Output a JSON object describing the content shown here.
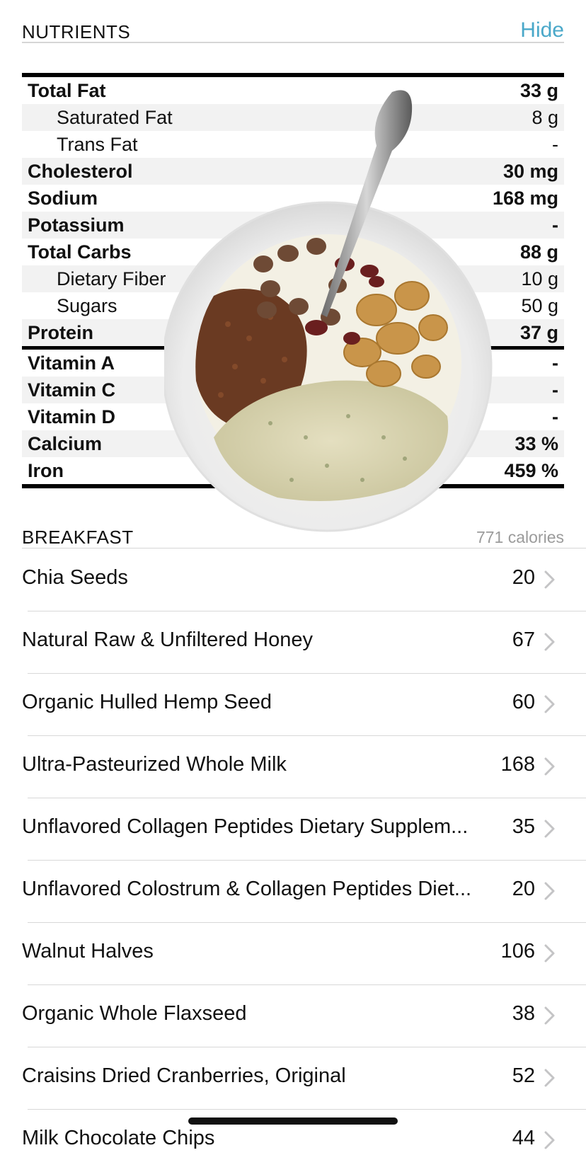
{
  "nutrients_header": {
    "title": "NUTRIENTS",
    "hide_label": "Hide"
  },
  "nutrients": [
    {
      "label": "Total Fat",
      "value": "33 g",
      "style": "bold"
    },
    {
      "label": "Saturated Fat",
      "value": "8 g",
      "style": "sub"
    },
    {
      "label": "Trans Fat",
      "value": "-",
      "style": "sub"
    },
    {
      "label": "Cholesterol",
      "value": "30 mg",
      "style": "bold"
    },
    {
      "label": "Sodium",
      "value": "168 mg",
      "style": "bold"
    },
    {
      "label": "Potassium",
      "value": "-",
      "style": "bold"
    },
    {
      "label": "Total Carbs",
      "value": "88 g",
      "style": "bold"
    },
    {
      "label": "Dietary Fiber",
      "value": "10 g",
      "style": "sub"
    },
    {
      "label": "Sugars",
      "value": "50 g",
      "style": "sub"
    },
    {
      "label": "Protein",
      "value": "37 g",
      "style": "bold"
    },
    {
      "label": "Vitamin A",
      "value": "-",
      "style": "bold"
    },
    {
      "label": "Vitamin C",
      "value": "-",
      "style": "bold"
    },
    {
      "label": "Vitamin D",
      "value": "-",
      "style": "bold"
    },
    {
      "label": "Calcium",
      "value": "33 %",
      "style": "bold"
    },
    {
      "label": "Iron",
      "value": "459 %",
      "style": "bold"
    }
  ],
  "meal": {
    "title": "BREAKFAST",
    "calories": "771 calories"
  },
  "foods": [
    {
      "name": "Chia Seeds",
      "calories": "20"
    },
    {
      "name": "Natural Raw & Unfiltered Honey",
      "calories": "67"
    },
    {
      "name": "Organic Hulled Hemp Seed",
      "calories": "60"
    },
    {
      "name": "Ultra-Pasteurized Whole Milk",
      "calories": "168"
    },
    {
      "name": "Unflavored Collagen Peptides Dietary Supplem...",
      "calories": "35"
    },
    {
      "name": "Unflavored Colostrum & Collagen Peptides Diet...",
      "calories": "20"
    },
    {
      "name": "Walnut Halves",
      "calories": "106"
    },
    {
      "name": "Organic Whole Flaxseed",
      "calories": "38"
    },
    {
      "name": "Craisins Dried Cranberries, Original",
      "calories": "52"
    },
    {
      "name": "Milk Chocolate Chips",
      "calories": "44"
    }
  ],
  "colors": {
    "accent": "#4aa8c9",
    "muted": "#9b9b9b"
  },
  "icons": {
    "row_chevron": "chevron-right-icon",
    "photo": "oatmeal-bowl-photo"
  }
}
